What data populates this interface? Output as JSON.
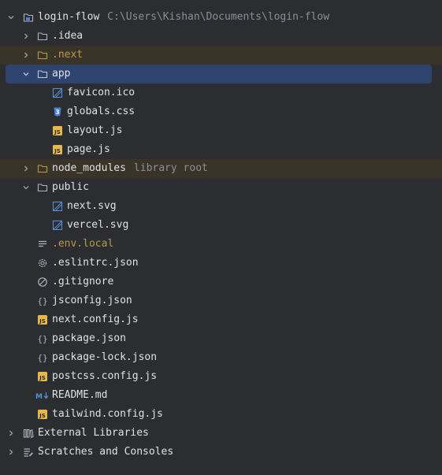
{
  "project": {
    "name": "login-flow",
    "path": "C:\\Users\\Kishan\\Documents\\login-flow"
  },
  "folders": {
    "idea": ".idea",
    "next": ".next",
    "app": "app",
    "node_modules": "node_modules",
    "node_modules_hint": "library root",
    "public": "public"
  },
  "app_files": {
    "favicon": "favicon.ico",
    "globals": "globals.css",
    "layout": "layout.js",
    "page": "page.js"
  },
  "public_files": {
    "next_svg": "next.svg",
    "vercel_svg": "vercel.svg"
  },
  "root_files": {
    "env_local": ".env.local",
    "eslintrc": ".eslintrc.json",
    "gitignore": ".gitignore",
    "jsconfig": "jsconfig.json",
    "next_config": "next.config.js",
    "package_json": "package.json",
    "package_lock": "package-lock.json",
    "postcss_config": "postcss.config.js",
    "readme": "README.md",
    "tailwind_config": "tailwind.config.js"
  },
  "bottom": {
    "external_libraries": "External Libraries",
    "scratches": "Scratches and Consoles"
  },
  "colors": {
    "background": "#2b2d30",
    "selected": "#2e436e",
    "excluded_bg": "#3a3428",
    "excluded_text": "#b89a4e",
    "js_badge": "#e8b94a",
    "css_badge": "#4a7fd9",
    "image_icon": "#5a8fd8"
  },
  "icons": {
    "chevron_down": "chevron-down-icon",
    "chevron_right": "chevron-right-icon",
    "project": "project-folder-icon",
    "folder": "folder-icon",
    "image": "image-file-icon",
    "css": "css-file-icon",
    "js": "js-file-icon",
    "text": "text-file-icon",
    "config": "gear-config-icon",
    "ignore": "ignore-file-icon",
    "json": "json-file-icon",
    "markdown": "markdown-file-icon",
    "library": "library-icon",
    "scratches": "scratches-icon"
  }
}
